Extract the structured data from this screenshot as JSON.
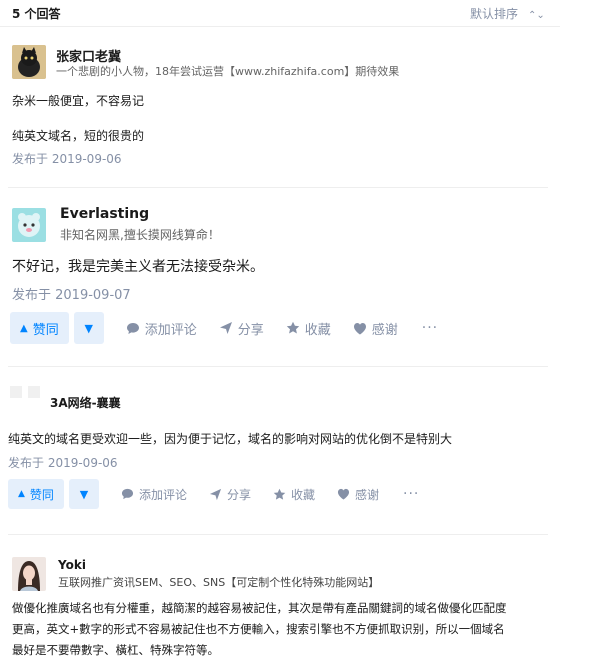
{
  "header": {
    "answer_count": "5 个回答",
    "sort_label": "默认排序"
  },
  "answers": [
    {
      "name": "张家口老冀",
      "bio": "一个悲剧的小人物，18年尝试运营【www.zhifazhifa.com】期待效果",
      "paragraphs": [
        "杂米一般便宜，不容易记",
        "纯英文域名，短的很贵的"
      ],
      "date": "发布于 2019-09-06"
    },
    {
      "name": "Everlasting",
      "bio": "非知名网黑,擅长摸网线算命！",
      "paragraphs": [
        "不好记，我是完美主义者无法接受杂米。"
      ],
      "date": "发布于 2019-09-07",
      "actions": {
        "upvote": "赞同",
        "comment": "添加评论",
        "share": "分享",
        "collect": "收藏",
        "thanks": "感谢",
        "more": "···"
      }
    },
    {
      "name": "3A网络-襄襄",
      "bio": "",
      "paragraphs": [
        "纯英文的域名更受欢迎一些，因为便于记忆，域名的影响对网站的优化倒不是特别大"
      ],
      "date": "发布于 2019-09-06",
      "actions": {
        "upvote": "赞同",
        "comment": "添加评论",
        "share": "分享",
        "collect": "收藏",
        "thanks": "感谢",
        "more": "···"
      }
    },
    {
      "name": "Yoki",
      "bio": "互联网推广资讯SEM、SEO、SNS【可定制个性化特殊功能网站】",
      "paragraphs": [
        "做優化推廣域名也有分權重，越簡潔的越容易被記住，其次是帶有產品關鍵詞的域名做優化匹配度",
        "更高，英文+數字的形式不容易被記住也不方便輸入，搜索引擎也不方便抓取识别，所以一個域名",
        "最好是不要帶數字、橫杠、特殊字符等。"
      ]
    }
  ],
  "colors": {
    "accent": "#0084ff",
    "vote_bg": "#e5effb",
    "meta": "#8590a6",
    "text": "#1a1a1a"
  }
}
